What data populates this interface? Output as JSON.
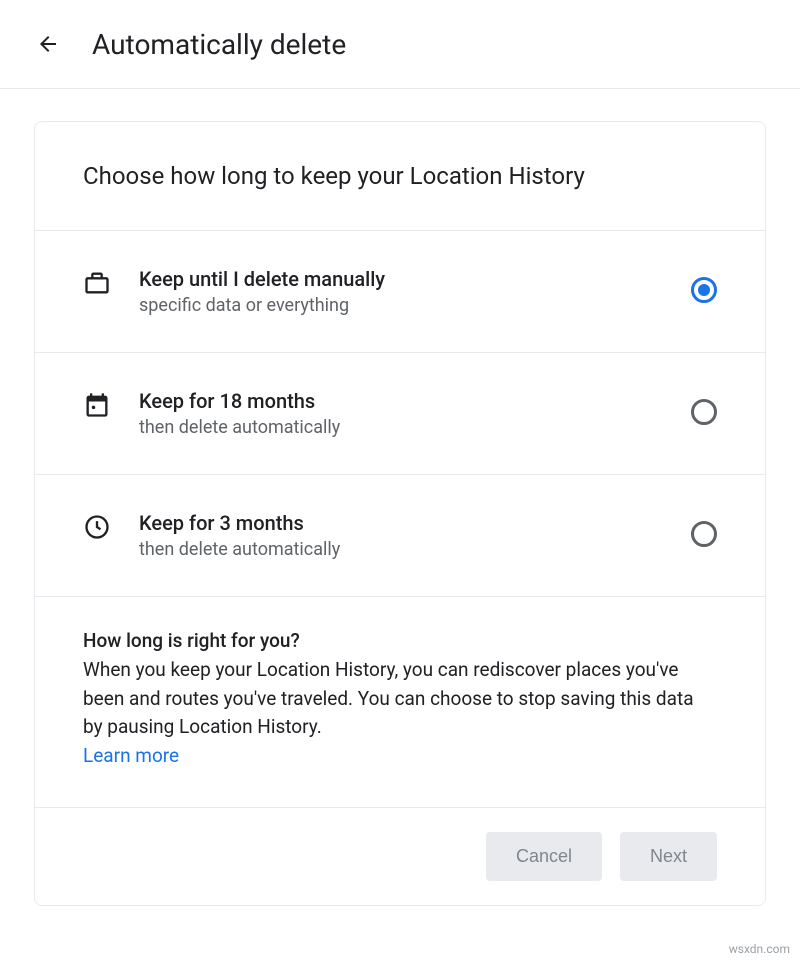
{
  "header": {
    "title": "Automatically delete"
  },
  "card": {
    "title": "Choose how long to keep your Location History"
  },
  "options": [
    {
      "icon": "briefcase-icon",
      "title": "Keep until I delete manually",
      "subtitle": "specific data or everything",
      "selected": true
    },
    {
      "icon": "calendar-icon",
      "title": "Keep for 18 months",
      "subtitle": "then delete automatically",
      "selected": false
    },
    {
      "icon": "clock-icon",
      "title": "Keep for 3 months",
      "subtitle": "then delete automatically",
      "selected": false
    }
  ],
  "info": {
    "title": "How long is right for you?",
    "text": "When you keep your Location History, you can rediscover places you've been and routes you've traveled. You can choose to stop saving this data by pausing Location History.",
    "learn_more": "Learn more"
  },
  "footer": {
    "cancel": "Cancel",
    "next": "Next"
  },
  "watermark": "wsxdn.com"
}
